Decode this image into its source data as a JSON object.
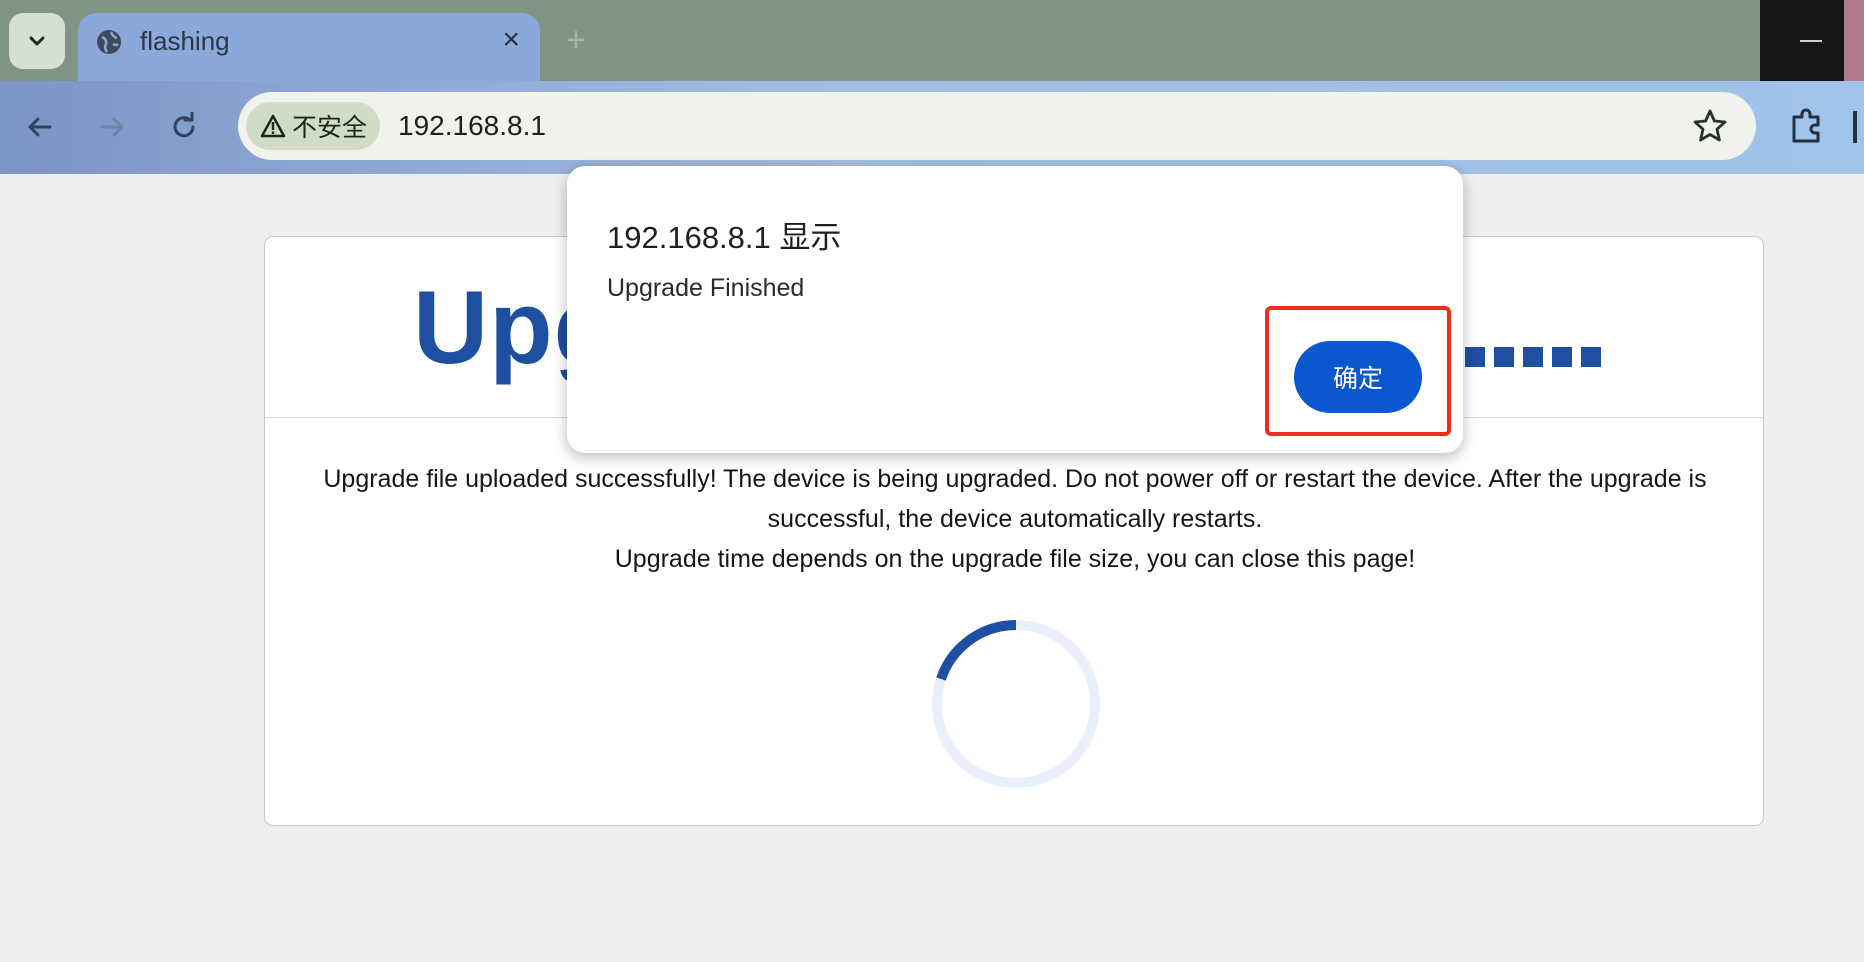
{
  "browser": {
    "tab": {
      "title": "flashing",
      "close_glyph": "×"
    },
    "new_tab_glyph": "+",
    "address_bar": {
      "security_label": "不安全",
      "url": "192.168.8.1"
    },
    "icons": {
      "tab_search": "chevron-down-icon",
      "favicon": "globe-icon",
      "back": "arrow-left-icon",
      "forward": "arrow-right-icon",
      "reload": "reload-icon",
      "warning": "warning-triangle-icon",
      "bookmark": "star-icon",
      "extensions": "puzzle-icon"
    }
  },
  "page": {
    "title": "Upgrading",
    "message_line1": "Upgrade file uploaded successfully! The device is being upgraded. Do not power off or restart the device. After the upgrade is successful, the device automatically restarts.",
    "message_line2": "Upgrade time depends on the upgrade file size, you can close this page!",
    "spinner_color": "#1f4fa0"
  },
  "dialog": {
    "title": "192.168.8.1 显示",
    "message": "Upgrade Finished",
    "ok_label": "确定",
    "accent_color": "#0b57d0",
    "highlight_color": "#ef2d1e"
  }
}
